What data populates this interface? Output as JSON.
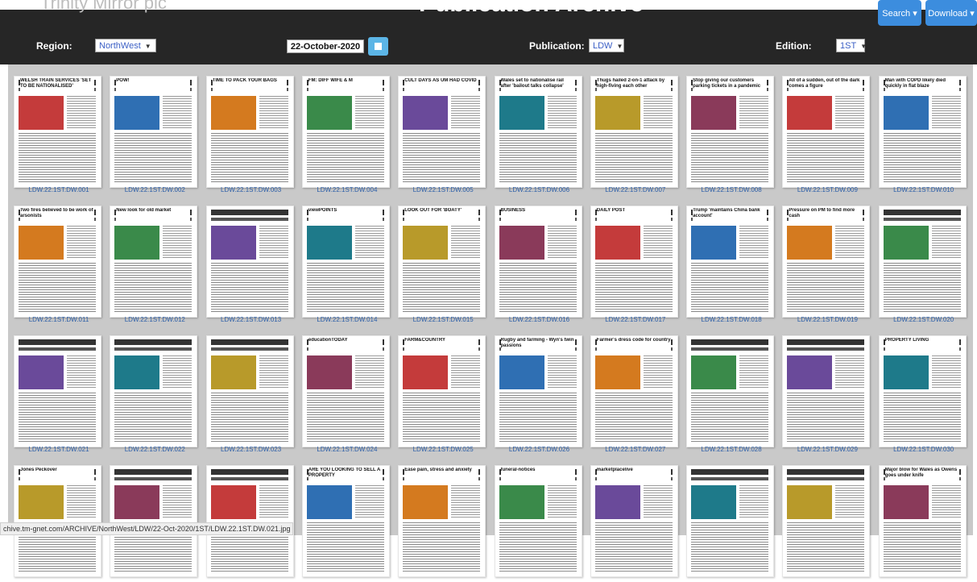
{
  "header": {
    "brand": "Trinity Mirror plc",
    "title": "Publication Archive",
    "search_label": "Search ▾",
    "download_label": "Download ▾"
  },
  "filters": {
    "region_label": "Region:",
    "region_value": "NorthWest",
    "date_value": "22-October-2020",
    "publication_label": "Publication:",
    "publication_value": "LDW",
    "edition_label": "Edition:",
    "edition_value": "1ST"
  },
  "colors": {
    "topbar": "#262626",
    "accent": "#3c8dde",
    "grid_bg": "#c9c9c9",
    "link": "#2d5fa8"
  },
  "pages": [
    {
      "label": "LDW.22.1ST.DW.001",
      "headline": "WELSH TRAIN SERVICES 'SET TO BE NATIONALISED'"
    },
    {
      "label": "LDW.22.1ST.DW.002",
      "headline": "POW!"
    },
    {
      "label": "LDW.22.1ST.DW.003",
      "headline": "TIME TO PACK YOUR BAGS"
    },
    {
      "label": "LDW.22.1ST.DW.004",
      "headline": "FM: DIFF WIFE & M"
    },
    {
      "label": "LDW.22.1ST.DW.005",
      "headline": "CULT DAYS AS UM HAD COVID"
    },
    {
      "label": "LDW.22.1ST.DW.006",
      "headline": "Wales set to nationalise rail after 'bailout talks collapse'"
    },
    {
      "label": "LDW.22.1ST.DW.007",
      "headline": "Thugs hailed 2-on-1 attack by high-fiving each other"
    },
    {
      "label": "LDW.22.1ST.DW.008",
      "headline": "Stop giving our customers parking tickets in a pandemic"
    },
    {
      "label": "LDW.22.1ST.DW.009",
      "headline": "All of a sudden, out of the dark comes a figure"
    },
    {
      "label": "LDW.22.1ST.DW.010",
      "headline": "Man with COPD likely died quickly in flat blaze"
    },
    {
      "label": "LDW.22.1ST.DW.011",
      "headline": "Two fires believed to be work of arsonists"
    },
    {
      "label": "LDW.22.1ST.DW.012",
      "headline": "New look for old market"
    },
    {
      "label": "LDW.22.1ST.DW.013",
      "headline": ""
    },
    {
      "label": "LDW.22.1ST.DW.014",
      "headline": "viewPOINTS"
    },
    {
      "label": "LDW.22.1ST.DW.015",
      "headline": "LOOK OUT FOR 'BOATY'"
    },
    {
      "label": "LDW.22.1ST.DW.016",
      "headline": "BUSINESS"
    },
    {
      "label": "LDW.22.1ST.DW.017",
      "headline": "DAILY POST"
    },
    {
      "label": "LDW.22.1ST.DW.018",
      "headline": "Trump 'maintains China bank account'"
    },
    {
      "label": "LDW.22.1ST.DW.019",
      "headline": "Pressure on PM to find more cash"
    },
    {
      "label": "LDW.22.1ST.DW.020",
      "headline": ""
    },
    {
      "label": "LDW.22.1ST.DW.021",
      "headline": ""
    },
    {
      "label": "LDW.22.1ST.DW.022",
      "headline": ""
    },
    {
      "label": "LDW.22.1ST.DW.023",
      "headline": ""
    },
    {
      "label": "LDW.22.1ST.DW.024",
      "headline": "educationTODAY"
    },
    {
      "label": "LDW.22.1ST.DW.025",
      "headline": "FARM&COUNTRY"
    },
    {
      "label": "LDW.22.1ST.DW.026",
      "headline": "Rugby and farming - Wyn's twin passions"
    },
    {
      "label": "LDW.22.1ST.DW.027",
      "headline": "Farmer's dress code for country"
    },
    {
      "label": "LDW.22.1ST.DW.028",
      "headline": ""
    },
    {
      "label": "LDW.22.1ST.DW.029",
      "headline": ""
    },
    {
      "label": "LDW.22.1ST.DW.030",
      "headline": "PROPERTY LIVING"
    },
    {
      "label": "",
      "headline": "Jones Peckover"
    },
    {
      "label": "",
      "headline": ""
    },
    {
      "label": "",
      "headline": ""
    },
    {
      "label": "",
      "headline": "ARE YOU LOOKING TO SELL A PROPERTY"
    },
    {
      "label": "",
      "headline": "Ease pain, stress and anxiety"
    },
    {
      "label": "",
      "headline": "funeral-notices"
    },
    {
      "label": "",
      "headline": "marketplacelive"
    },
    {
      "label": "",
      "headline": ""
    },
    {
      "label": "",
      "headline": ""
    },
    {
      "label": "",
      "headline": "Major blow for Wales as Owens goes under knife"
    }
  ],
  "status_url": "chive.tm-gnet.com/ARCHIVE/NorthWest/LDW/22-Oct-2020/1ST/LDW.22.1ST.DW.021.jpg"
}
